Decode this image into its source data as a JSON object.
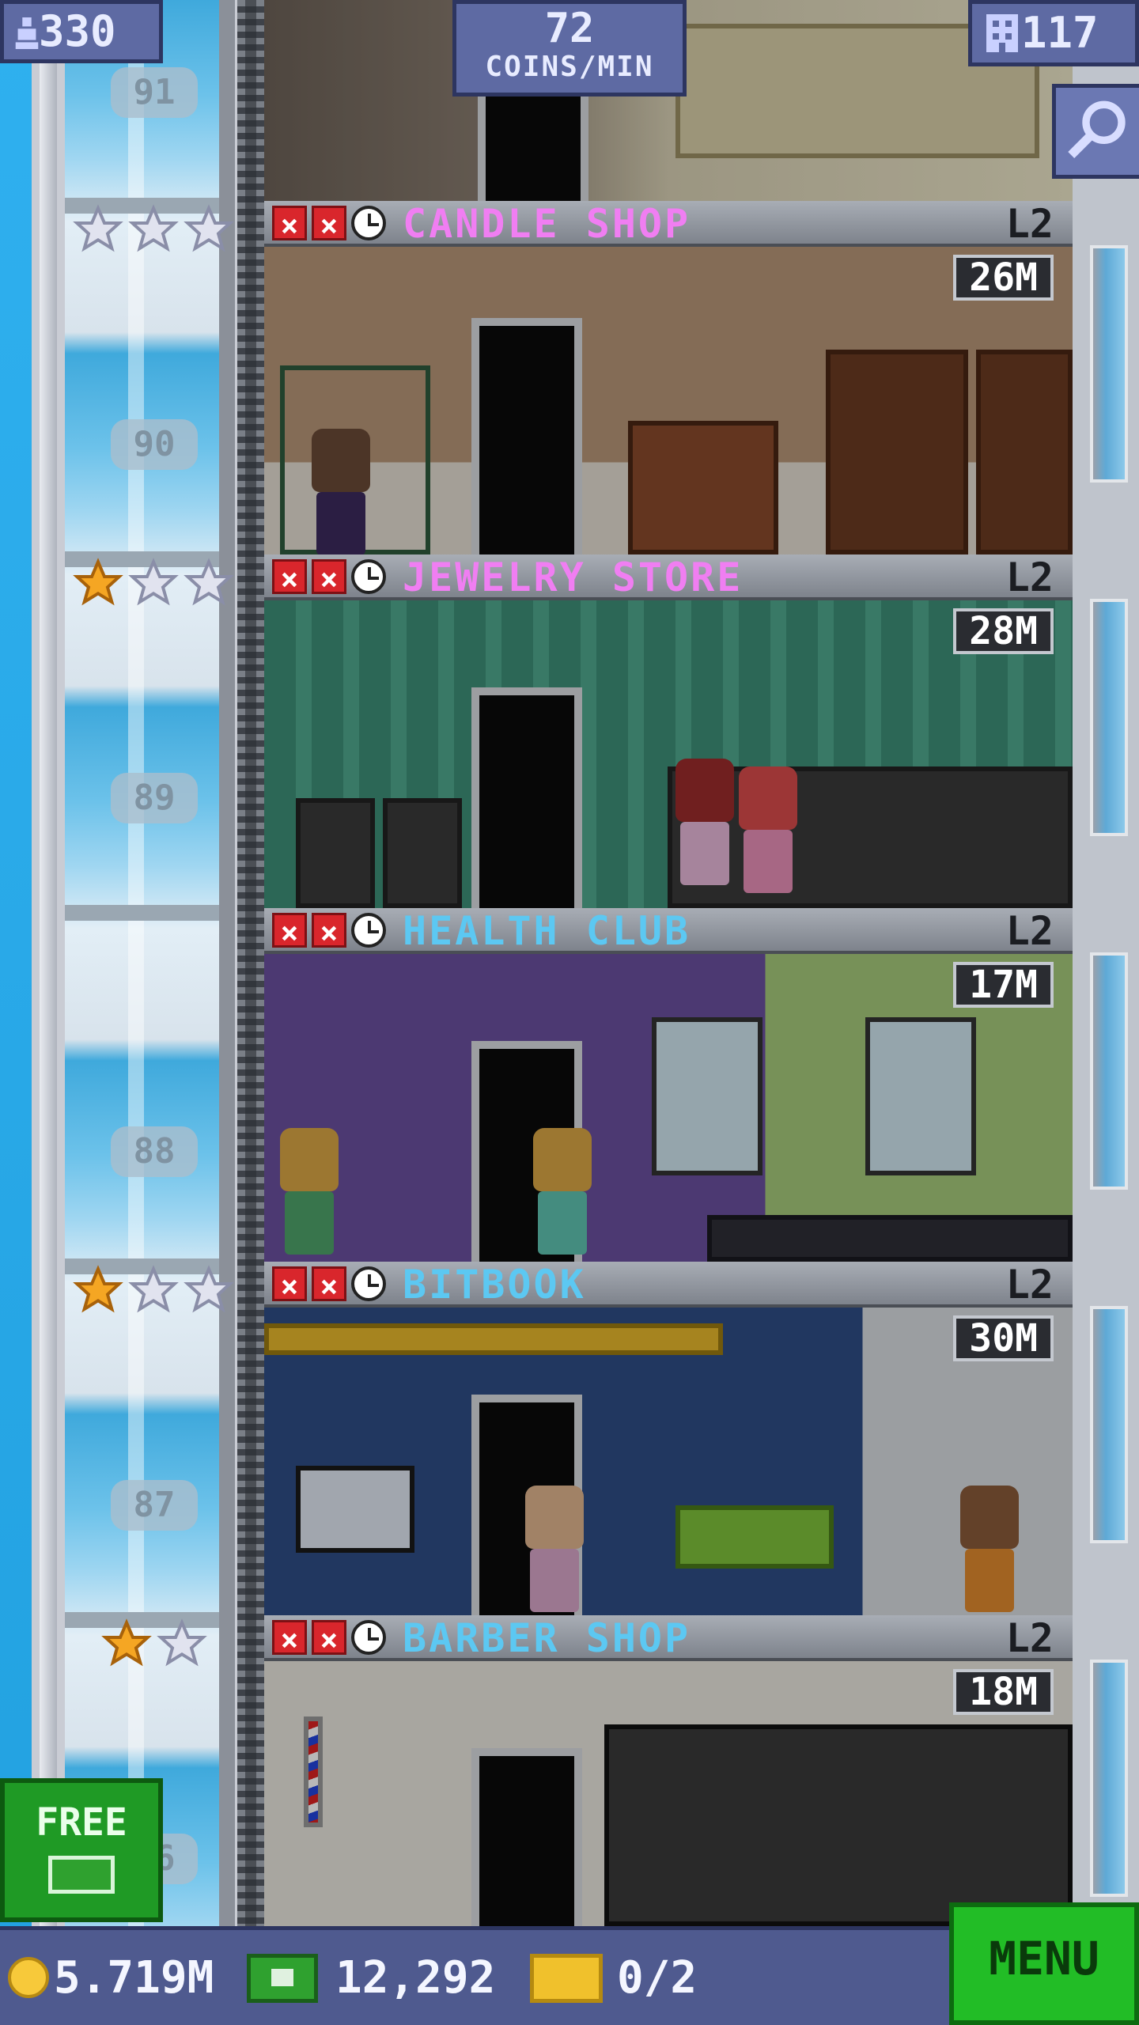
{
  "top_bar": {
    "population": "330",
    "population_icon": "person-icon",
    "coins_rate_value": "72",
    "coins_rate_unit": "COINS/MIN",
    "floor_count": "117",
    "floor_count_icon": "building-icon",
    "search_icon": "magnifier-icon"
  },
  "elevator": {
    "floor_numbers": [
      "91",
      "90",
      "89",
      "88",
      "87",
      "86"
    ]
  },
  "floors": [
    {
      "name": "CANDLE SHOP",
      "level": "L2",
      "timer": "26M",
      "name_color": "#f07ef2",
      "stars_filled": 0,
      "stars_total": 3
    },
    {
      "name": "JEWELRY STORE",
      "level": "L2",
      "timer": "28M",
      "name_color": "#f07ef2",
      "stars_filled": 1,
      "stars_total": 3
    },
    {
      "name": "HEALTH CLUB",
      "level": "L2",
      "timer": "17M",
      "name_color": "#5cc8f2",
      "stars_filled": 0,
      "stars_total": 0
    },
    {
      "name": "BITBOOK",
      "level": "L2",
      "timer": "30M",
      "name_color": "#5cc8f2",
      "stars_filled": 1,
      "stars_total": 3
    },
    {
      "name": "BARBER SHOP",
      "level": "L2",
      "timer": "18M",
      "name_color": "#5cc8f2",
      "stars_filled": 1,
      "stars_total": 2
    }
  ],
  "free_button": {
    "label": "FREE"
  },
  "bottom_bar": {
    "coins": "5.719M",
    "bux": "12,292",
    "tickets": "0/2"
  },
  "menu_button": {
    "label": "MENU"
  },
  "colors": {
    "chip_bg": "#5e6aa3",
    "menu_green": "#22bd26",
    "star_gold": "#f5a623",
    "star_empty": "#d9dbe8"
  }
}
